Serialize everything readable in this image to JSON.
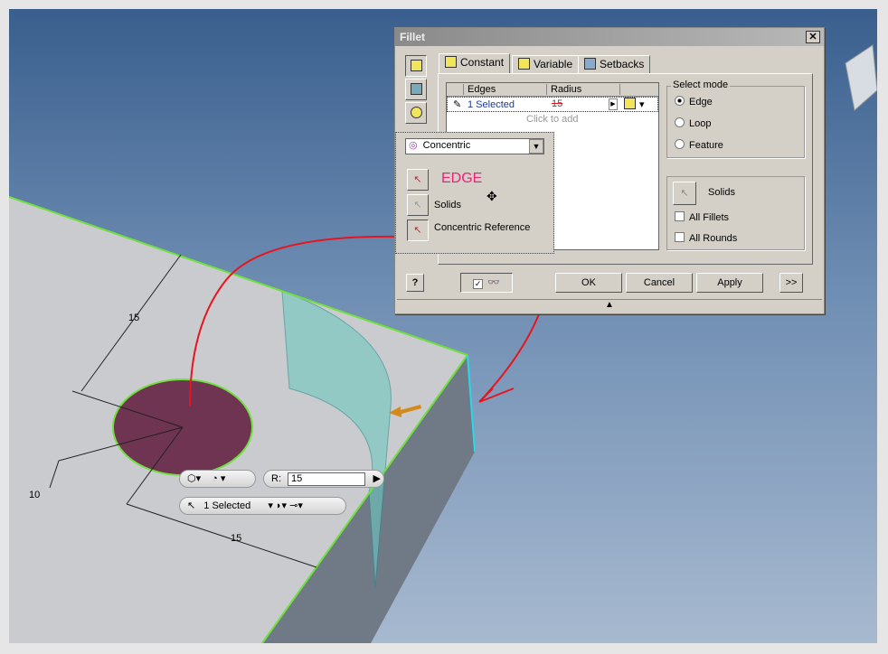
{
  "dialog": {
    "title": "Fillet",
    "close": "✕",
    "tabs": [
      {
        "label": "Constant",
        "active": true
      },
      {
        "label": "Variable"
      },
      {
        "label": "Setbacks"
      }
    ],
    "table": {
      "headers": [
        "Edges",
        "Radius"
      ],
      "row": {
        "edges": "1 Selected",
        "radius": "15"
      },
      "add_hint": "Click to add"
    },
    "select_mode": {
      "label": "Select mode",
      "options": [
        "Edge",
        "Loop",
        "Feature"
      ],
      "selected": "Edge"
    },
    "solids_label": "Solids",
    "all_fillets": "All Fillets",
    "all_rounds": "All Rounds",
    "buttons": {
      "help": "?",
      "ok": "OK",
      "cancel": "Cancel",
      "apply": "Apply",
      "more": ">>"
    },
    "preview_checked": true
  },
  "popup": {
    "dropdown_value": "Concentric",
    "edge_label": "EDGE",
    "solids_label": "Solids",
    "concentric_ref_label": "Concentric Reference"
  },
  "minitoolbar": {
    "radius_label": "R:",
    "radius_value": "15",
    "selected": "1 Selected"
  },
  "dimensions": [
    "15",
    "15",
    "10"
  ],
  "colors": {
    "annotation": "#e8141e",
    "edge_label": "#e8247a",
    "highlight": "#6fe03c",
    "hole": "#6e3452"
  }
}
